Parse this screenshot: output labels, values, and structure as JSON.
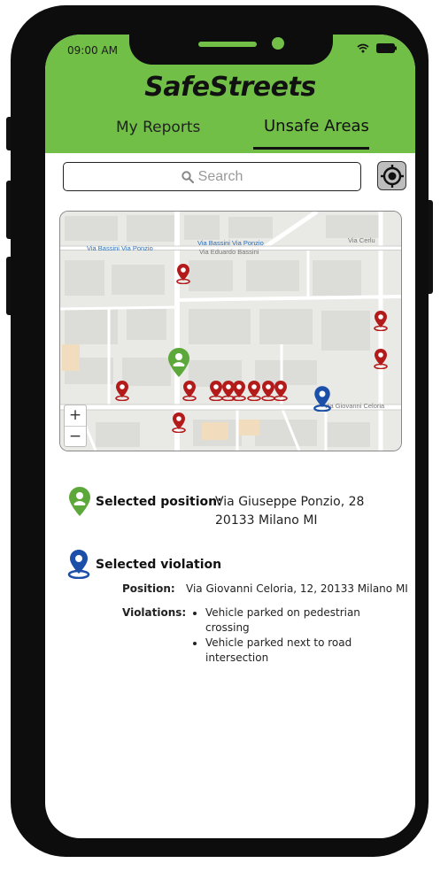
{
  "status_bar": {
    "time": "09:00 AM"
  },
  "app": {
    "title": "SafeStreets"
  },
  "tabs": [
    {
      "label": "My Reports",
      "active": false
    },
    {
      "label": "Unsafe Areas",
      "active": true
    }
  ],
  "search": {
    "placeholder": "Search"
  },
  "map": {
    "streets": [
      "Via Bassini Via Ponzio",
      "Via Bassini Via Ponzio",
      "Via Eduardo Bassini",
      "Via Cerlu",
      "Via Giovanni Celoria"
    ],
    "zoom_in": "+",
    "zoom_out": "−"
  },
  "selected_position": {
    "label": "Selected position:",
    "address_line1": "Via Giuseppe Ponzio, 28",
    "address_line2": "20133 Milano MI"
  },
  "selected_violation": {
    "label": "Selected violation",
    "position_label": "Position:",
    "position_value": "Via Giovanni Celoria, 12, 20133 Milano MI",
    "violations_label": "Violations:",
    "violations": [
      "Vehicle parked on pedestrian crossing",
      "Vehicle parked next to road intersection"
    ]
  },
  "colors": {
    "brand_green": "#72bf48",
    "pin_red": "#b31b1b",
    "pin_blue": "#1b4fa8",
    "pin_green": "#5da83b"
  }
}
